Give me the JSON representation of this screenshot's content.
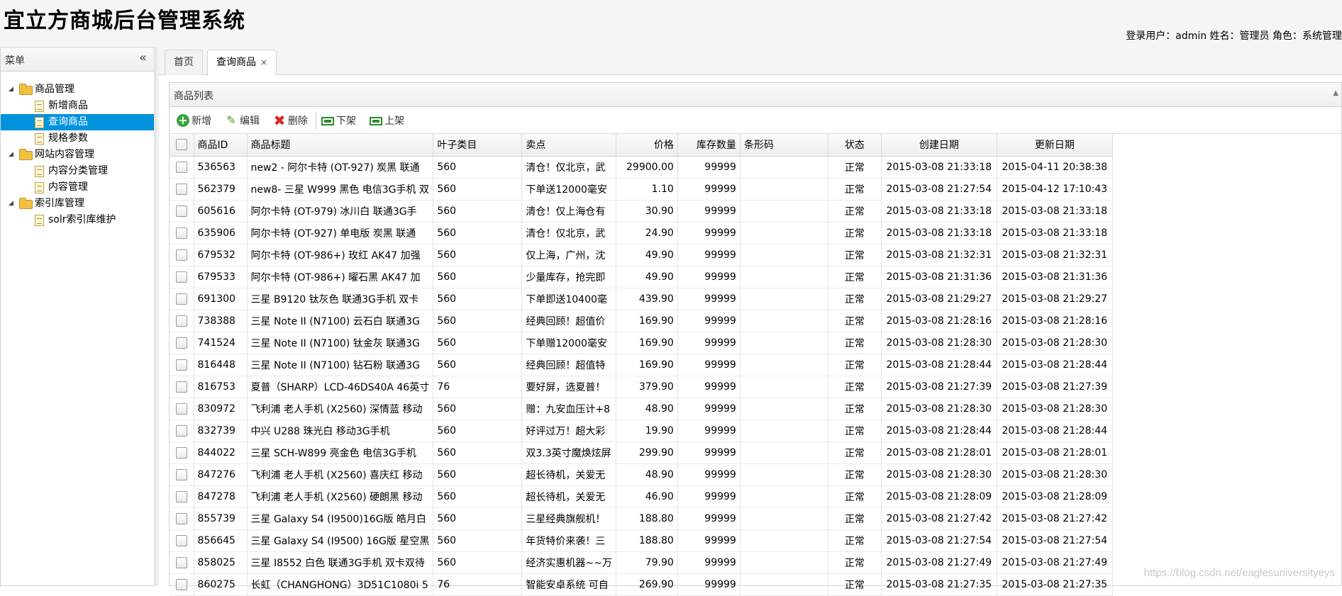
{
  "header": {
    "title": "宜立方商城后台管理系统",
    "user_info": "登录用户：admin  姓名：管理员  角色：系统管理"
  },
  "menu": {
    "title": "菜单",
    "collapse_icon": "double-chevron-left-icon",
    "groups": [
      {
        "label": "商品管理",
        "items": [
          "新增商品",
          "查询商品",
          "规格参数"
        ]
      },
      {
        "label": "网站内容管理",
        "items": [
          "内容分类管理",
          "内容管理"
        ]
      },
      {
        "label": "索引库管理",
        "items": [
          "solr索引库维护"
        ]
      }
    ],
    "selected": "查询商品"
  },
  "tabs": [
    {
      "label": "首页",
      "active": false,
      "closable": false
    },
    {
      "label": "查询商品",
      "active": true,
      "closable": true,
      "close_glyph": "×"
    }
  ],
  "panel": {
    "title": "商品列表",
    "toolbar": {
      "add": "新增",
      "edit": "编辑",
      "delete": "删除",
      "offline": "下架",
      "online": "上架"
    }
  },
  "grid": {
    "columns": [
      "商品ID",
      "商品标题",
      "叶子类目",
      "卖点",
      "价格",
      "库存数量",
      "条形码",
      "状态",
      "创建日期",
      "更新日期"
    ],
    "rows": [
      [
        "536563",
        "new2 - 阿尔卡特 (OT-927) 炭黑 联通",
        "560",
        "清仓！仅北京，武",
        "29900.00",
        "99999",
        "",
        "正常",
        "2015-03-08 21:33:18",
        "2015-04-11 20:38:38"
      ],
      [
        "562379",
        "new8- 三星 W999 黑色 电信3G手机 双",
        "560",
        "下单送12000毫安",
        "1.10",
        "99999",
        "",
        "正常",
        "2015-03-08 21:27:54",
        "2015-04-12 17:10:43"
      ],
      [
        "605616",
        "阿尔卡特 (OT-979) 冰川白 联通3G手",
        "560",
        "清仓！仅上海仓有",
        "30.90",
        "99999",
        "",
        "正常",
        "2015-03-08 21:33:18",
        "2015-03-08 21:33:18"
      ],
      [
        "635906",
        "阿尔卡特 (OT-927) 单电版 炭黑 联通",
        "560",
        "清仓！仅北京，武",
        "24.90",
        "99999",
        "",
        "正常",
        "2015-03-08 21:33:18",
        "2015-03-08 21:33:18"
      ],
      [
        "679532",
        "阿尔卡特 (OT-986+) 玫红 AK47 加强",
        "560",
        "仅上海，广州，沈",
        "49.90",
        "99999",
        "",
        "正常",
        "2015-03-08 21:32:31",
        "2015-03-08 21:32:31"
      ],
      [
        "679533",
        "阿尔卡特 (OT-986+) 曜石黑 AK47 加",
        "560",
        "少量库存，抢完即",
        "49.90",
        "99999",
        "",
        "正常",
        "2015-03-08 21:31:36",
        "2015-03-08 21:31:36"
      ],
      [
        "691300",
        "三星 B9120 钛灰色 联通3G手机 双卡",
        "560",
        "下单即送10400毫",
        "439.90",
        "99999",
        "",
        "正常",
        "2015-03-08 21:29:27",
        "2015-03-08 21:29:27"
      ],
      [
        "738388",
        "三星 Note II (N7100) 云石白 联通3G",
        "560",
        "经典回顾！超值价",
        "169.90",
        "99999",
        "",
        "正常",
        "2015-03-08 21:28:16",
        "2015-03-08 21:28:16"
      ],
      [
        "741524",
        "三星 Note II (N7100) 钛金灰 联通3G",
        "560",
        "下单赠12000毫安",
        "169.90",
        "99999",
        "",
        "正常",
        "2015-03-08 21:28:30",
        "2015-03-08 21:28:30"
      ],
      [
        "816448",
        "三星 Note II (N7100) 钻石粉 联通3G",
        "560",
        "经典回顾！超值特",
        "169.90",
        "99999",
        "",
        "正常",
        "2015-03-08 21:28:44",
        "2015-03-08 21:28:44"
      ],
      [
        "816753",
        "夏普（SHARP）LCD-46DS40A 46英寸",
        "76",
        "要好屏，选夏普！",
        "379.90",
        "99999",
        "",
        "正常",
        "2015-03-08 21:27:39",
        "2015-03-08 21:27:39"
      ],
      [
        "830972",
        "飞利浦 老人手机 (X2560) 深情蓝 移动",
        "560",
        "赠：九安血压计+8",
        "48.90",
        "99999",
        "",
        "正常",
        "2015-03-08 21:28:30",
        "2015-03-08 21:28:30"
      ],
      [
        "832739",
        "中兴 U288 珠光白 移动3G手机",
        "560",
        "好评过万！超大彩",
        "19.90",
        "99999",
        "",
        "正常",
        "2015-03-08 21:28:44",
        "2015-03-08 21:28:44"
      ],
      [
        "844022",
        "三星 SCH-W899 亮金色 电信3G手机",
        "560",
        "双3.3英寸魔焕炫屏",
        "299.90",
        "99999",
        "",
        "正常",
        "2015-03-08 21:28:01",
        "2015-03-08 21:28:01"
      ],
      [
        "847276",
        "飞利浦 老人手机 (X2560) 喜庆红 移动",
        "560",
        "超长待机，关爱无",
        "48.90",
        "99999",
        "",
        "正常",
        "2015-03-08 21:28:30",
        "2015-03-08 21:28:30"
      ],
      [
        "847278",
        "飞利浦 老人手机 (X2560) 硬朗黑 移动",
        "560",
        "超长待机，关爱无",
        "46.90",
        "99999",
        "",
        "正常",
        "2015-03-08 21:28:09",
        "2015-03-08 21:28:09"
      ],
      [
        "855739",
        "三星 Galaxy S4 (I9500)16G版 皓月白",
        "560",
        "三星经典旗舰机！",
        "188.80",
        "99999",
        "",
        "正常",
        "2015-03-08 21:27:42",
        "2015-03-08 21:27:42"
      ],
      [
        "856645",
        "三星 Galaxy S4 (I9500) 16G版 星空黑",
        "560",
        "年货特价来袭！三",
        "188.80",
        "99999",
        "",
        "正常",
        "2015-03-08 21:27:54",
        "2015-03-08 21:27:54"
      ],
      [
        "858025",
        "三星 I8552 白色 联通3G手机 双卡双待",
        "560",
        "经济实惠机器~~万",
        "79.90",
        "99999",
        "",
        "正常",
        "2015-03-08 21:27:49",
        "2015-03-08 21:27:49"
      ],
      [
        "860275",
        "长虹（CHANGHONG）3D51C1080i 5",
        "76",
        "智能安卓系统 可自",
        "269.90",
        "99999",
        "",
        "正常",
        "2015-03-08 21:27:35",
        "2015-03-08 21:27:35"
      ]
    ]
  },
  "watermark": "https://blog.csdn.net/eaglesuniversityeys",
  "colors": {
    "selected_bg": "#0092dc",
    "header_bg": "#f5f5f5",
    "grid_border": "#d3d3d3"
  }
}
